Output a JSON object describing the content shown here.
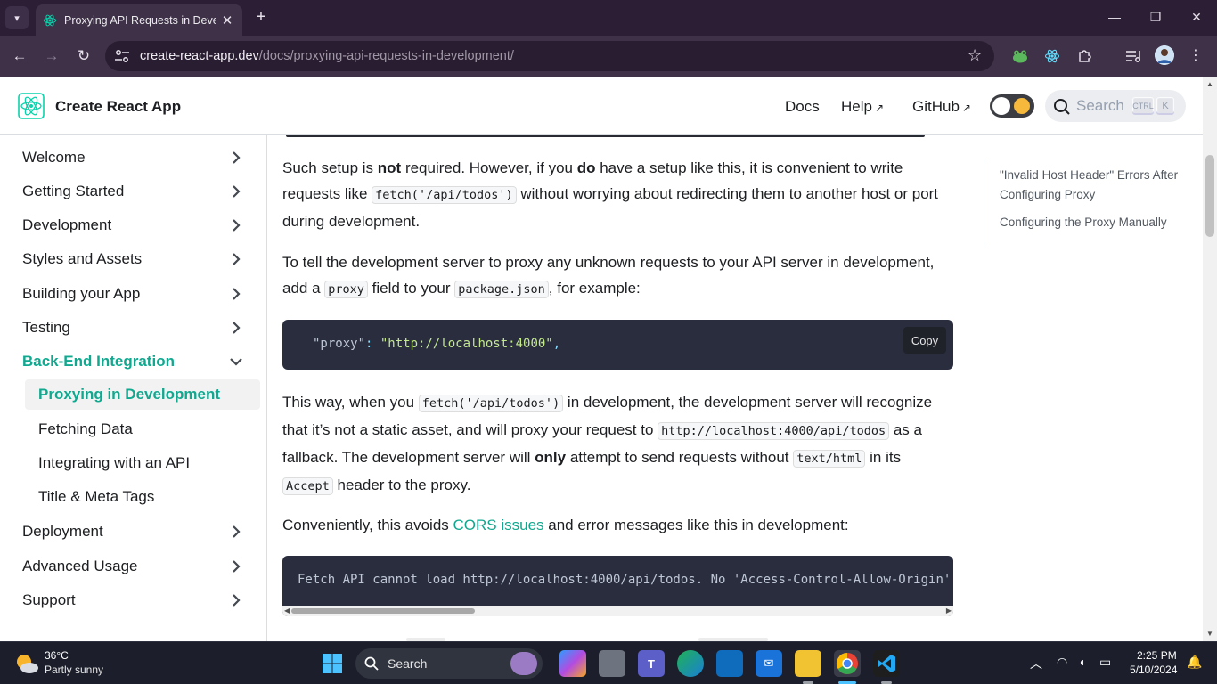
{
  "browser": {
    "tab_title": "Proxying API Requests in Devel",
    "url_host": "create-react-app.dev",
    "url_path": "/docs/proxying-api-requests-in-development/",
    "new_tab": "+",
    "close": "✕",
    "minimize": "—",
    "maximize": "❐",
    "window_close": "✕"
  },
  "site": {
    "brand": "Create React App",
    "nav": {
      "docs": "Docs",
      "help": "Help",
      "github": "GitHub"
    },
    "search_placeholder": "Search",
    "kbd_ctrl": "CTRL",
    "kbd_k": "K"
  },
  "sidebar": {
    "welcome": "Welcome",
    "getting_started": "Getting Started",
    "development": "Development",
    "styles_assets": "Styles and Assets",
    "building": "Building your App",
    "testing": "Testing",
    "backend": "Back-End Integration",
    "sub": {
      "proxying": "Proxying in Development",
      "fetching": "Fetching Data",
      "integrating": "Integrating with an API",
      "title_meta": "Title & Meta Tags"
    },
    "deployment": "Deployment",
    "advanced": "Advanced Usage",
    "support": "Support"
  },
  "content": {
    "p1": {
      "a": "Such setup is ",
      "b1": "not",
      "c": " required. However, if you ",
      "b2": "do",
      "d": " have a setup like this, it is convenient to write requests like ",
      "code1": "fetch('/api/todos')",
      "e": " without worrying about redirecting them to another host or port during development."
    },
    "p2": {
      "a": "To tell the development server to proxy any unknown requests to your API server in development, add a ",
      "code1": "proxy",
      "b": " field to your ",
      "code2": "package.json",
      "c": ", for example:"
    },
    "code_block_1": {
      "key": "\"proxy\"",
      "colon": ": ",
      "value": "\"http://localhost:4000\"",
      "comma": ","
    },
    "copy_label": "Copy",
    "p3": {
      "a": "This way, when you ",
      "code1": "fetch('/api/todos')",
      "b": " in development, the development server will recognize that it’s not a static asset, and will proxy your request to ",
      "code2": "http://localhost:4000/api/todos",
      "c": " as a fallback. The development server will ",
      "b1": "only",
      "d": " attempt to send requests without ",
      "code3": "text/html",
      "e": " in its ",
      "code4": "Accept",
      "f": " header to the proxy."
    },
    "p4": {
      "a": "Conveniently, this avoids ",
      "link": "CORS issues",
      "b": " and error messages like this in development:"
    },
    "code_block_2": "Fetch API cannot load http://localhost:4000/api/todos. No 'Access-Control-Allow-Origin'"
  },
  "toc": {
    "item1": "\"Invalid Host Header\" Errors After Configuring Proxy",
    "item2": "Configuring the Proxy Manually"
  },
  "taskbar": {
    "temp": "36°C",
    "weather": "Partly sunny",
    "search": "Search",
    "time": "2:25 PM",
    "date": "5/10/2024"
  },
  "colors": {
    "accent": "#11a88f",
    "code_bg": "#292d3e",
    "browser_frame": "#3e3148"
  }
}
